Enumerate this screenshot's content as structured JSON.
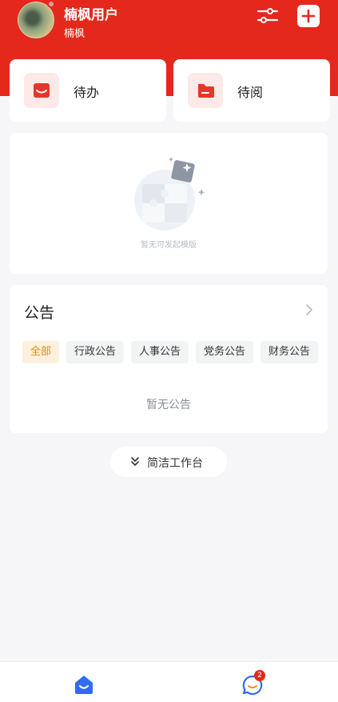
{
  "header": {
    "user_name": "楠枫用户",
    "user_sub": "楠枫"
  },
  "quick": {
    "todo_label": "待办",
    "read_label": "待阅"
  },
  "template": {
    "empty_text": "暂无可发起模版"
  },
  "notice": {
    "title": "公告",
    "tabs": [
      "全部",
      "行政公告",
      "人事公告",
      "党务公告",
      "财务公告"
    ],
    "active_tab": "全部",
    "empty_text": "暂无公告"
  },
  "simple_workbench": {
    "label": "简洁工作台"
  },
  "bottom_nav": {
    "message_badge": "2"
  },
  "colors": {
    "brand_red": "#e5281c",
    "active_tab_text": "#e08a1e",
    "active_tab_bg": "#fdf0dc",
    "nav_blue": "#2f6bf5"
  }
}
